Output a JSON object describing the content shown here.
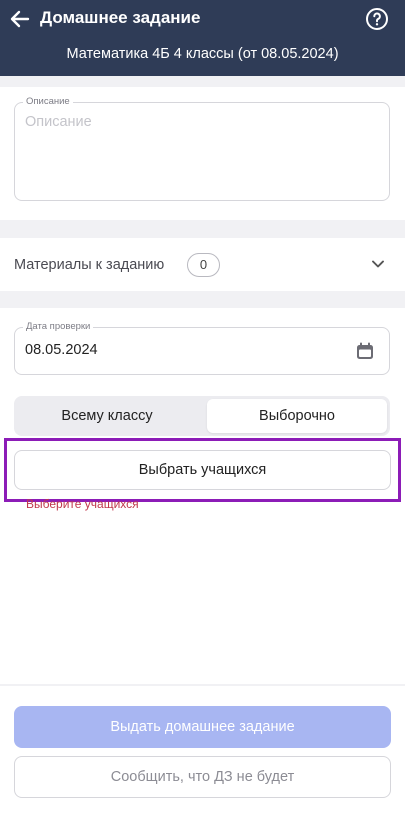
{
  "header": {
    "title": "Домашнее задание",
    "subtitle": "Математика 4Б 4 классы (от 08.05.2024)",
    "back_icon": "arrow-left-icon",
    "help_icon": "question-circle-icon"
  },
  "description": {
    "label": "Описание",
    "placeholder": "Описание"
  },
  "materials": {
    "label": "Материалы к заданию",
    "count": "0",
    "icon": "chevron-down-icon"
  },
  "check_date": {
    "label": "Дата проверки",
    "value": "08.05.2024",
    "icon": "calendar-icon"
  },
  "assign_mode": {
    "options": [
      "Всему классу",
      "Выборочно"
    ],
    "selected": "Выборочно"
  },
  "select_students": {
    "button_label": "Выбрать учащихся",
    "error": "Выберите учащихся"
  },
  "actions": {
    "primary_label": "Выдать домашнее задание",
    "secondary_label": "Сообщить, что ДЗ не будет"
  },
  "colors": {
    "header_bg": "#2f3c57",
    "primary_disabled": "#a8b6f2",
    "error": "#c0394d",
    "highlight": "#8c1cb7"
  }
}
